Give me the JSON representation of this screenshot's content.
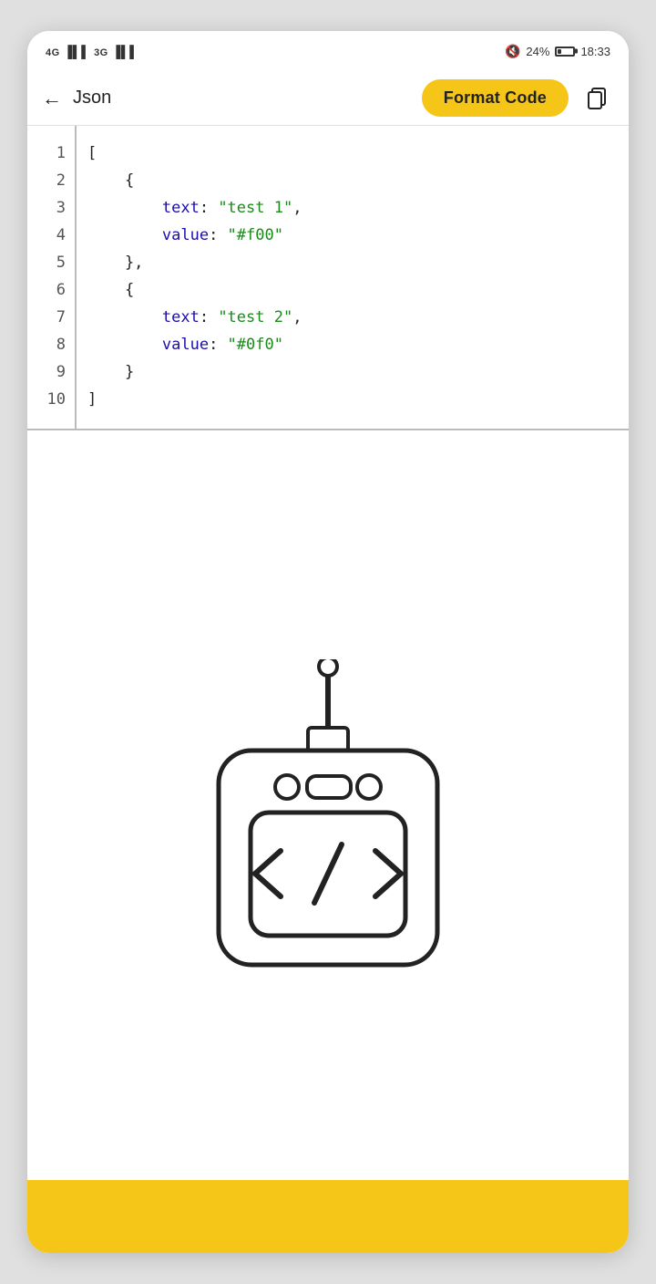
{
  "statusBar": {
    "left": "⁴⁶ .ull ³⁶.ull",
    "signal": "46  36",
    "mute": "🔇",
    "battery_pct": "24%",
    "time": "18:33"
  },
  "nav": {
    "back_label": "←",
    "title": "Json",
    "format_btn_label": "Format Code",
    "copy_icon": "copy"
  },
  "codeEditor": {
    "lines": [
      {
        "num": "1",
        "tokens": [
          {
            "type": "punct",
            "text": "["
          }
        ]
      },
      {
        "num": "2",
        "tokens": [
          {
            "type": "punct",
            "text": "    {"
          }
        ]
      },
      {
        "num": "3",
        "tokens": [
          {
            "type": "kw",
            "text": "        text"
          },
          {
            "type": "punct",
            "text": ": "
          },
          {
            "type": "str",
            "text": "\"test 1\""
          },
          {
            "type": "punct",
            "text": ","
          }
        ]
      },
      {
        "num": "4",
        "tokens": [
          {
            "type": "kw",
            "text": "        value"
          },
          {
            "type": "punct",
            "text": ": "
          },
          {
            "type": "str",
            "text": "\"#f00\""
          }
        ]
      },
      {
        "num": "5",
        "tokens": [
          {
            "type": "punct",
            "text": "    },"
          }
        ]
      },
      {
        "num": "6",
        "tokens": [
          {
            "type": "punct",
            "text": "    {"
          }
        ]
      },
      {
        "num": "7",
        "tokens": [
          {
            "type": "kw",
            "text": "        text"
          },
          {
            "type": "punct",
            "text": ": "
          },
          {
            "type": "str",
            "text": "\"test 2\""
          },
          {
            "type": "punct",
            "text": ","
          }
        ]
      },
      {
        "num": "8",
        "tokens": [
          {
            "type": "kw",
            "text": "        value"
          },
          {
            "type": "punct",
            "text": ": "
          },
          {
            "type": "str",
            "text": "\"#0f0\""
          }
        ]
      },
      {
        "num": "9",
        "tokens": [
          {
            "type": "punct",
            "text": "    }"
          }
        ]
      },
      {
        "num": "10",
        "tokens": [
          {
            "type": "punct",
            "text": "]"
          }
        ]
      }
    ]
  },
  "colors": {
    "accent": "#f5c518",
    "keyword_color": "#1a0dab",
    "string_color": "#1a8a1a",
    "punct_color": "#222222"
  }
}
